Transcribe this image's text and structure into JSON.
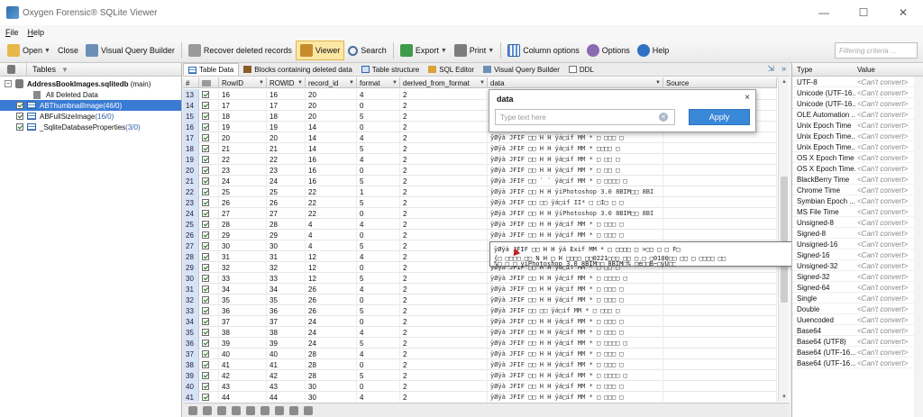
{
  "window": {
    "title": "Oxygen Forensic® SQLite Viewer",
    "minimize": "—",
    "maximize": "☐",
    "close": "✕"
  },
  "menu": [
    "File",
    "Help"
  ],
  "toolbar": {
    "open": "Open",
    "close": "Close",
    "visual_query_builder": "Visual Query Builder",
    "recover": "Recover deleted records",
    "viewer": "Viewer",
    "search": "Search",
    "export": "Export",
    "print": "Print",
    "column_options": "Column options",
    "options": "Options",
    "help": "Help",
    "filter_placeholder": "Filtering criteria ..."
  },
  "left_panel": {
    "header": "Tables",
    "db": {
      "name": "AddressBookImages.sqlitedb",
      "suffix": "(main)"
    },
    "items": [
      {
        "label": "All Deleted Data",
        "count": ""
      },
      {
        "label": "ABThumbnailImage",
        "count": "(46/0)",
        "selected": true
      },
      {
        "label": "ABFullSizeImage",
        "count": "(16/0)",
        "selected": false
      },
      {
        "label": "_SqliteDatabaseProperties",
        "count": "(3/0)",
        "selected": false
      }
    ]
  },
  "tabs": [
    "Table Data",
    "Blocks containing deleted data",
    "Table structure",
    "SQL Editor",
    "Visual Query Builder",
    "DDL"
  ],
  "tabs_ctrl": {
    "pin": "⇲",
    "more": "»"
  },
  "grid": {
    "columns": [
      "#",
      "",
      "RowID",
      "ROWID",
      "record_id",
      "format",
      "derived_from_format",
      "data",
      "Source"
    ],
    "rows": [
      [
        "13",
        "16",
        "16",
        "20",
        "4",
        "2",
        "ÿØÿà JFIF    H H  ÿá Exif  MM *"
      ],
      [
        "14",
        "17",
        "17",
        "20",
        "0",
        "2",
        "ÿØÿà JFIF    H H  ÿá Exif  MM *"
      ],
      [
        "15",
        "18",
        "18",
        "20",
        "5",
        "2",
        "ÿØÿà JFIF    H H  ÿá Exif  MM *"
      ],
      [
        "16",
        "19",
        "19",
        "14",
        "0",
        "2",
        "ÿØÿà JFIF    H H  ÿá Exif  MM *"
      ],
      [
        "17",
        "20",
        "20",
        "14",
        "4",
        "2",
        "ÿØÿà JFIF  □□ H H  ÿá□if  MM *  □ □□□ □"
      ],
      [
        "18",
        "21",
        "21",
        "14",
        "5",
        "2",
        "ÿØÿà JFIF  □□ H H  ÿá□if  MM *  □□□□ □"
      ],
      [
        "19",
        "22",
        "22",
        "16",
        "4",
        "2",
        "ÿØÿà JFIF  □□ H H  ÿá□if  MM *  □ □□ □"
      ],
      [
        "20",
        "23",
        "23",
        "16",
        "0",
        "2",
        "ÿØÿà JFIF  □□ H H  ÿá□if  MM *  □ □□ □"
      ],
      [
        "21",
        "24",
        "24",
        "16",
        "5",
        "2",
        "ÿØÿà JFIF  □□ ` `  ÿá□if  MM *  □ □□□□ □"
      ],
      [
        "22",
        "25",
        "25",
        "22",
        "1",
        "2",
        "ÿØÿà JFIF  □□ H H  ÿíPhotoshop 3.0 8BIM□□    8BI"
      ],
      [
        "23",
        "26",
        "26",
        "22",
        "5",
        "2",
        "ÿØÿà JFIF  □□ □□   ÿá□if  II*  □ □I□ □ □"
      ],
      [
        "24",
        "27",
        "27",
        "22",
        "0",
        "2",
        "ÿØÿà JFIF  □□ H H  ÿíPhotoshop 3.0 8BIM□□    8BI"
      ],
      [
        "25",
        "28",
        "28",
        "4",
        "4",
        "2",
        "ÿØÿà JFIF  □□ H H  ÿá□if  MM *  □ □□□ □"
      ],
      [
        "26",
        "29",
        "29",
        "4",
        "0",
        "2",
        "ÿØÿà JFIF  □□ H H  ÿá□if  MM *  □ □□□ □"
      ],
      [
        "27",
        "30",
        "30",
        "4",
        "5",
        "2",
        "ÿØÿà JFIF  □□ H H  ÿá□if  MM *  □ □□□□ □  >□□ □ □ F□"
      ],
      [
        "28",
        "31",
        "31",
        "12",
        "4",
        "2",
        "ÿØÿà JFIF  □□ H H  ÿá□if  MM *  □ □□□ □"
      ],
      [
        "29",
        "32",
        "32",
        "12",
        "0",
        "2",
        "ÿØÿà JFIF  □□ H H  ÿá□if  MM *  □ □□ □"
      ],
      [
        "30",
        "33",
        "33",
        "12",
        "5",
        "2",
        "ÿØÿà JFIF  □□ H H  ÿá□if  MM *  □ □□□□ □"
      ],
      [
        "31",
        "34",
        "34",
        "26",
        "4",
        "2",
        "ÿØÿà JFIF  □□ H H  ÿá□if  MM *  □ □□□ □"
      ],
      [
        "32",
        "35",
        "35",
        "26",
        "0",
        "2",
        "ÿØÿà JFIF  □□ H H  ÿá□if  MM *  □ □□□ □"
      ],
      [
        "33",
        "36",
        "36",
        "26",
        "5",
        "2",
        "ÿØÿà JFIF  □□ □□   ÿá□if  MM *  □ □□□ □"
      ],
      [
        "34",
        "37",
        "37",
        "24",
        "0",
        "2",
        "ÿØÿà JFIF  □□ H H  ÿá□if  MM *  □ □□□ □"
      ],
      [
        "35",
        "38",
        "38",
        "24",
        "4",
        "2",
        "ÿØÿà JFIF  □□ H H  ÿá□if  MM *  □ □□□ □"
      ],
      [
        "36",
        "39",
        "39",
        "24",
        "5",
        "2",
        "ÿØÿà JFIF  □□ H H  ÿá□if  MM *  □ □□□□ □"
      ],
      [
        "37",
        "40",
        "40",
        "28",
        "4",
        "2",
        "ÿØÿà JFIF  □□ H H  ÿá□if  MM *  □ □□□ □"
      ],
      [
        "38",
        "41",
        "41",
        "28",
        "0",
        "2",
        "ÿØÿà JFIF  □□ H H  ÿá□if  MM *  □ □□□ □"
      ],
      [
        "39",
        "42",
        "42",
        "28",
        "5",
        "2",
        "ÿØÿà JFIF  □□ H H  ÿá□if  MM *  □ □□□□ □"
      ],
      [
        "40",
        "43",
        "43",
        "30",
        "0",
        "2",
        "ÿØÿà JFIF  □□ H H  ÿá□if  MM *  □ □□□ □"
      ],
      [
        "41",
        "44",
        "44",
        "30",
        "4",
        "2",
        "ÿØÿà JFIF  □□ H H  ÿá□if  MM *  □ □□□ □"
      ]
    ]
  },
  "popup": {
    "title": "data",
    "close": "×",
    "placeholder": "Type text here",
    "clear": "✕",
    "apply": "Apply"
  },
  "tooltip": {
    "line1": "ÿØÿà JFIF  □□ H H  ÿá Exif  MM *  □ □□□□ □  >□□ □ □ F□",
    "line2": "{□  □□□□ □□ N    H □  H  □□□□ □□0221□□□ □□ □  □ □0100□□ □□ □ □□□□ □□",
    "line3": "%□ □  □  ÿíPhotoshop 3.0 8BIM□□    8BIM□%   □é□□B~□ÿÛ□□"
  },
  "right_panel": {
    "headers": [
      "Type",
      "Value"
    ],
    "rows": [
      [
        "UTF-8",
        "<Can't convert>"
      ],
      [
        "Unicode (UTF-16...",
        "<Can't convert>"
      ],
      [
        "Unicode (UTF-16...",
        "<Can't convert>"
      ],
      [
        "OLE Automation ...",
        "<Can't convert>"
      ],
      [
        "Unix Epoch Time",
        "<Can't convert>"
      ],
      [
        "Unix Epoch Time...",
        "<Can't convert>"
      ],
      [
        "Unix Epoch Time...",
        "<Can't convert>"
      ],
      [
        "OS X Epoch Time",
        "<Can't convert>"
      ],
      [
        "OS X Epoch Time...",
        "<Can't convert>"
      ],
      [
        "BlackBerry Time",
        "<Can't convert>"
      ],
      [
        "Chrome Time",
        "<Can't convert>"
      ],
      [
        "Symbian Epoch ...",
        "<Can't convert>"
      ],
      [
        "MS File Time",
        "<Can't convert>"
      ],
      [
        "Unsigned-8",
        "<Can't convert>"
      ],
      [
        "Signed-8",
        "<Can't convert>"
      ],
      [
        "Unsigned-16",
        "<Can't convert>"
      ],
      [
        "Signed-16",
        "<Can't convert>"
      ],
      [
        "Unsigned-32",
        "<Can't convert>"
      ],
      [
        "Signed-32",
        "<Can't convert>"
      ],
      [
        "Signed-64",
        "<Can't convert>"
      ],
      [
        "Single",
        "<Can't convert>"
      ],
      [
        "Double",
        "<Can't convert>"
      ],
      [
        "Uuencoded",
        "<Can't convert>"
      ],
      [
        "Base64",
        "<Can't convert>"
      ],
      [
        "Base64 (UTF8)",
        "<Can't convert>"
      ],
      [
        "Base64 (UTF-16...",
        "<Can't convert>"
      ],
      [
        "Base64 (UTF-16...",
        "<Can't convert>"
      ]
    ]
  },
  "colors": {
    "selection": "#3a7bd5",
    "row_number_bg": "#d7e3f4",
    "active_button": "#fde7a4",
    "apply_button": "#3a88d8"
  }
}
